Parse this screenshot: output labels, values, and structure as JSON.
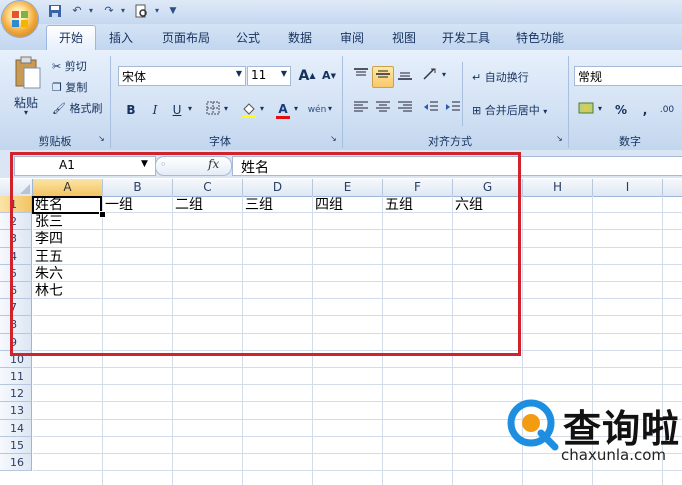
{
  "quick_access": {
    "save_icon": "save-icon",
    "undo_icon": "undo-icon",
    "redo_icon": "redo-icon",
    "print_preview_icon": "print-preview-icon",
    "customize_icon": "dropdown-icon"
  },
  "tabs": [
    "开始",
    "插入",
    "页面布局",
    "公式",
    "数据",
    "审阅",
    "视图",
    "开发工具",
    "特色功能"
  ],
  "ribbon": {
    "clipboard": {
      "paste": "粘贴",
      "cut": "剪切",
      "copy": "复制",
      "format_painter": "格式刷",
      "label": "剪贴板"
    },
    "font": {
      "name": "宋体",
      "size": "11",
      "bold": "B",
      "italic": "I",
      "underline": "U",
      "label": "字体",
      "grow": "A",
      "shrink": "A",
      "wen": "wén",
      "font_color": "A"
    },
    "alignment": {
      "wrap": "自动换行",
      "merge": "合并后居中",
      "label": "对齐方式"
    },
    "number": {
      "format": "常规",
      "percent": "%",
      "comma": ",",
      "label": "数字",
      "inc": ".00"
    }
  },
  "formula_bar": {
    "name_box": "A1",
    "fx": "fx",
    "content": "姓名"
  },
  "grid": {
    "columns": [
      "A",
      "B",
      "C",
      "D",
      "E",
      "F",
      "G",
      "H",
      "I"
    ],
    "rows": [
      "1",
      "2",
      "3",
      "4",
      "5",
      "6",
      "7",
      "8",
      "9",
      "10",
      "11",
      "12",
      "13",
      "14",
      "15",
      "16"
    ],
    "cells": {
      "A1": "姓名",
      "B1": "一组",
      "C1": "二组",
      "D1": "三组",
      "E1": "四组",
      "F1": "五组",
      "G1": "六组",
      "A2": "张三",
      "A3": "李四",
      "A4": "王五",
      "A5": "朱六",
      "A6": "林七"
    }
  },
  "watermark": {
    "text": "查询啦",
    "url": "chaxunla.com",
    "brand_color": "#1e8fe0",
    "accent_color": "#f39c12"
  },
  "colors": {
    "highlight": "#d0232e",
    "selected_header": "#f3c462"
  }
}
